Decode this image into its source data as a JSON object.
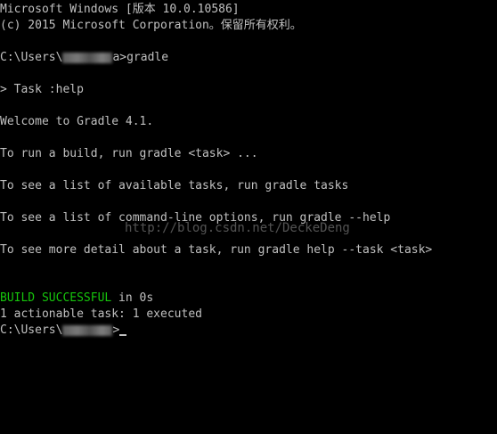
{
  "console": {
    "header_line1": "Microsoft Windows [版本 10.0.10586]",
    "header_line2": "(c) 2015 Microsoft Corporation。保留所有权利。",
    "prompt_prefix": "C:\\Users\\",
    "prompt_suffix_1": "a>gradle",
    "task_line": "> Task :help",
    "welcome": "Welcome to Gradle 4.1.",
    "run_build": "To run a build, run gradle <task> ...",
    "see_tasks": "To see a list of available tasks, run gradle tasks",
    "see_options": "To see a list of command-line options, run gradle --help",
    "see_detail": "To see more detail about a task, run gradle help --task <task>",
    "build_status": "BUILD SUCCESSFUL",
    "build_time": " in 0s",
    "actionable": "1 actionable task: 1 executed",
    "prompt_suffix_2": ">"
  },
  "watermark": "http://blog.csdn.net/DeckeDeng",
  "colors": {
    "background": "#000000",
    "text": "#c0c0c0",
    "success": "#16c60c"
  }
}
